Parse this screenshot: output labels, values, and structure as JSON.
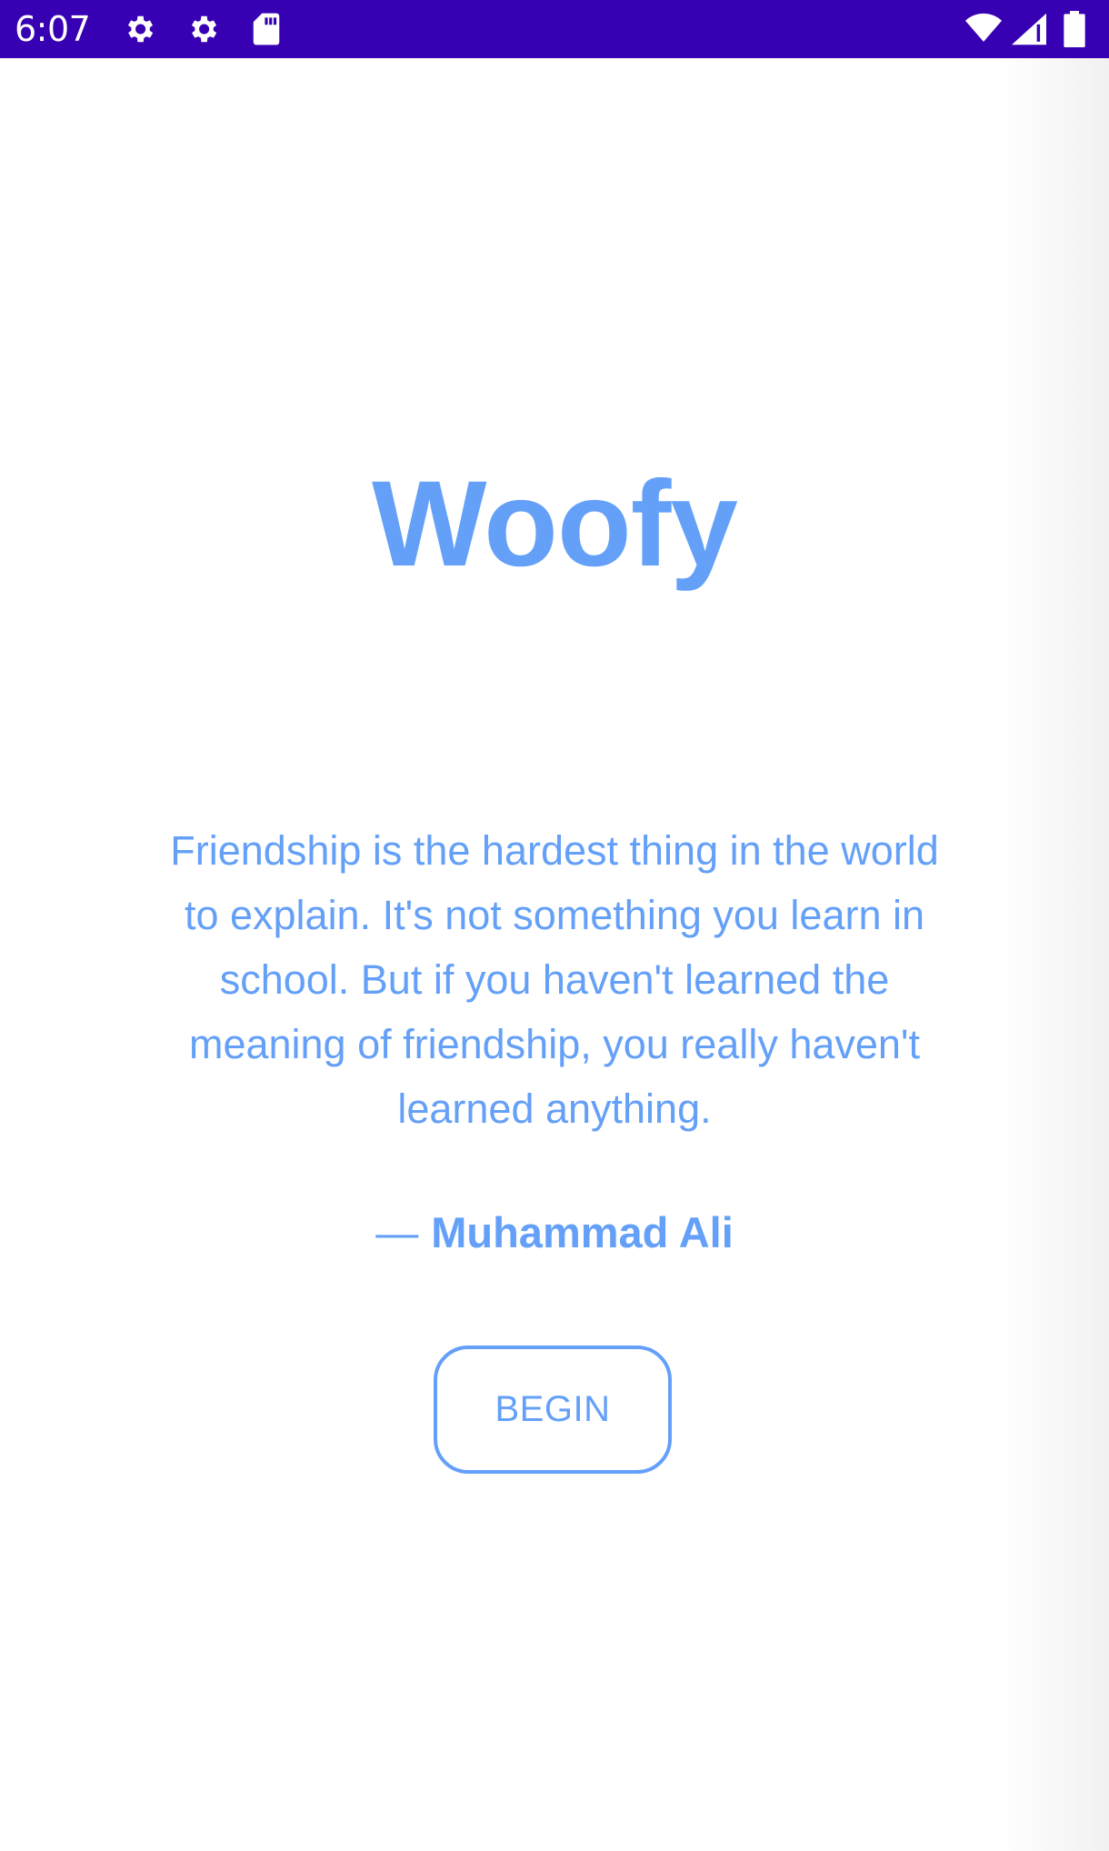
{
  "status_bar": {
    "time": "6:07",
    "background": "#3700b3",
    "left_icons": [
      "settings-icon",
      "settings-icon",
      "sd-card-icon"
    ],
    "right_icons": [
      "wifi-icon",
      "cell-signal-icon",
      "battery-icon"
    ]
  },
  "app": {
    "title": "Woofy",
    "quote": "Friendship is the hardest thing in the world to explain. It's not something you learn in school. But if you haven't learned the meaning of friendship, you really haven't learned anything.",
    "author_dash": "—",
    "author": "Muhammad Ali",
    "begin_label": "BEGIN",
    "accent_color": "#64a0f8"
  }
}
